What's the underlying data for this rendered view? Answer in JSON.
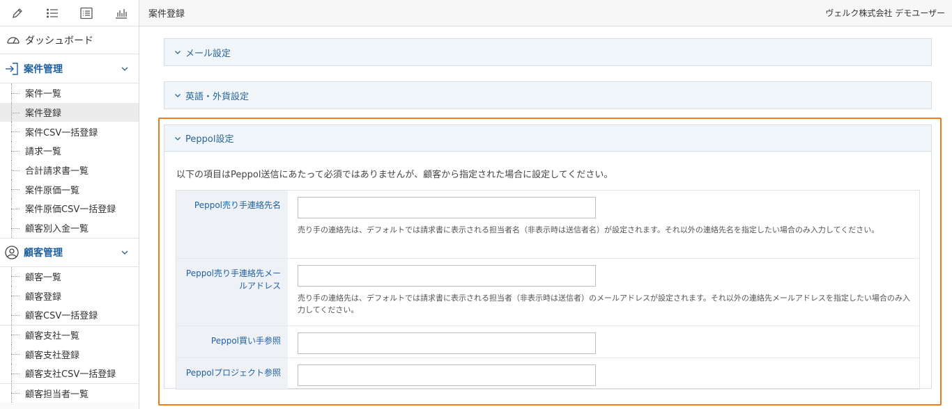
{
  "header": {
    "title": "案件登録",
    "user": "ヴェルク株式会社 デモユーザー"
  },
  "toolbar": {
    "icons": [
      "pencil-icon",
      "list-icon",
      "list-box-icon",
      "chart-icon"
    ]
  },
  "sidebar": {
    "dashboard": "ダッシュボード",
    "case_section": "案件管理",
    "case_items": [
      "案件一覧",
      "案件登録",
      "案件CSV一括登録",
      "請求一覧",
      "合計請求書一覧",
      "案件原価一覧",
      "案件原価CSV一括登録",
      "顧客別入金一覧"
    ],
    "active_item": "案件登録",
    "customer_section": "顧客管理",
    "customer_items_a": [
      "顧客一覧",
      "顧客登録",
      "顧客CSV一括登録"
    ],
    "customer_items_b": [
      "顧客支社一覧",
      "顧客支社登録",
      "顧客支社CSV一括登録"
    ],
    "customer_items_c": [
      "顧客担当者一覧"
    ]
  },
  "panels": {
    "mail": "メール設定",
    "english": "英語・外貨設定",
    "peppol": "Peppol設定"
  },
  "peppol": {
    "note": "以下の項目はPeppol送信にあたって必須ではありませんが、顧客から指定された場合に設定してください。",
    "fields": [
      {
        "label": "Peppol売り手連絡先名",
        "value": "",
        "help": "売り手の連絡先は、デフォルトでは請求書に表示される担当者名（非表示時は送信者名）が設定されます。それ以外の連絡先名を指定したい場合のみ入力してください。"
      },
      {
        "label": "Peppol売り手連絡先メールアドレス",
        "value": "",
        "help": "売り手の連絡先は、デフォルトでは請求書に表示される担当者（非表示時は送信者）のメールアドレスが設定されます。それ以外の連絡先メールアドレスを指定したい場合のみ入力してください。"
      },
      {
        "label": "Peppol買い手参照",
        "value": "",
        "help": ""
      },
      {
        "label": "Peppolプロジェクト参照",
        "value": "",
        "help": ""
      }
    ]
  },
  "colors": {
    "accent": "#1f5f9e",
    "highlight": "#f07b1d",
    "panel_header": "#f1f6fb"
  }
}
